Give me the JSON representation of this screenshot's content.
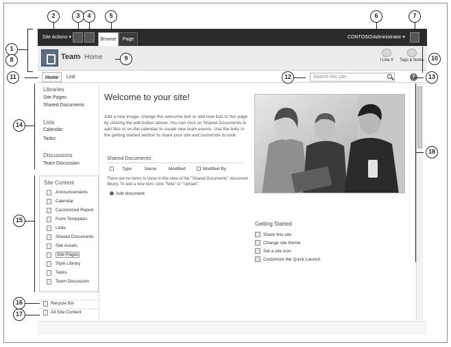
{
  "ribbon": {
    "site_actions": "Site Actions",
    "tab_browse": "Browse",
    "tab_page": "Page",
    "user": "CONTOSO\\Administrator",
    "dropdown_arrow": "▾"
  },
  "header": {
    "site_title": "Team",
    "breadcrumb_sep": "▸",
    "breadcrumb_current": "Home",
    "i_like_it": "I Like It",
    "tags_notes": "Tags & Notes"
  },
  "topnav": {
    "home": "Home",
    "link": "Link",
    "search_placeholder": "Search this site...",
    "help": "?"
  },
  "quick_launch": {
    "libraries_title": "Libraries",
    "libraries": [
      "Site Pages",
      "Shared Documents"
    ],
    "lists_title": "Lists",
    "lists": [
      "Calendar",
      "Tasks"
    ],
    "discussions_title": "Discussions",
    "discussions": [
      "Team Discussion"
    ]
  },
  "site_content": {
    "title": "Site Content",
    "items": [
      "Announcements",
      "Calendar",
      "Customized Report",
      "Form Templates",
      "Links",
      "Shared Documents",
      "Site Assets",
      "Site Pages",
      "Style Library",
      "Tasks",
      "Team Discussion"
    ],
    "selected_index": 7
  },
  "footer_links": {
    "recycle_bin": "Recycle Bin",
    "all_site_content": "All Site Content"
  },
  "main": {
    "welcome": "Welcome to your site!",
    "intro": "Add a new image, change this welcome text or add new lists to this page by clicking the edit button above. You can click on Shared Documents to add files or on the calendar to create new team events. Use the links in the getting started section to share your site and customize its look.",
    "shared_docs_title": "Shared Documents",
    "columns": [
      "Type",
      "Name",
      "Modified",
      "Modified By"
    ],
    "empty_message": "There are no items to show in this view of the \"Shared Documents\" document library. To add a new item, click \"New\" or \"Upload\".",
    "add_document": "Add document",
    "getting_started_title": "Getting Started",
    "getting_started": [
      "Share this site",
      "Change site theme",
      "Set a site icon",
      "Customize the Quick Launch"
    ]
  },
  "callouts": [
    "1",
    "2",
    "3",
    "4",
    "5",
    "6",
    "7",
    "8",
    "9",
    "10",
    "11",
    "12",
    "13",
    "14",
    "15",
    "16",
    "17",
    "18"
  ]
}
